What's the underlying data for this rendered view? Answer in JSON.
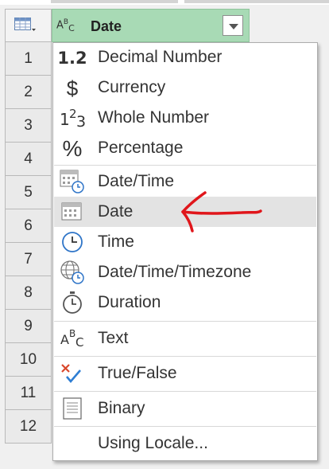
{
  "column": {
    "header": "Date",
    "type_icon": "date-type-icon"
  },
  "rows": [
    "1",
    "2",
    "3",
    "4",
    "5",
    "6",
    "7",
    "8",
    "9",
    "10",
    "11",
    "12"
  ],
  "menu": {
    "selected": "Date",
    "items": [
      {
        "label": "Decimal Number",
        "icon": "decimal-number-icon",
        "glyph": "1.2"
      },
      {
        "label": "Currency",
        "icon": "currency-icon",
        "glyph": "$"
      },
      {
        "label": "Whole Number",
        "icon": "whole-number-icon",
        "glyph": "123"
      },
      {
        "label": "Percentage",
        "icon": "percentage-icon",
        "glyph": "%"
      },
      {
        "label": "Date/Time",
        "icon": "date-time-icon"
      },
      {
        "label": "Date",
        "icon": "date-icon"
      },
      {
        "label": "Time",
        "icon": "clock-icon"
      },
      {
        "label": "Date/Time/Timezone",
        "icon": "globe-clock-icon"
      },
      {
        "label": "Duration",
        "icon": "stopwatch-icon"
      },
      {
        "label": "Text",
        "icon": "text-abc-icon",
        "glyph": "ABC"
      },
      {
        "label": "True/False",
        "icon": "true-false-icon"
      },
      {
        "label": "Binary",
        "icon": "binary-document-icon"
      },
      {
        "label": "Using Locale...",
        "icon": ""
      }
    ]
  },
  "colors": {
    "header_bg": "#a8dab5",
    "selected_bg": "#e3e3e3",
    "annotation_arrow": "#e0161b",
    "false_x": "#d9472b",
    "true_check": "#2e7ed3"
  }
}
